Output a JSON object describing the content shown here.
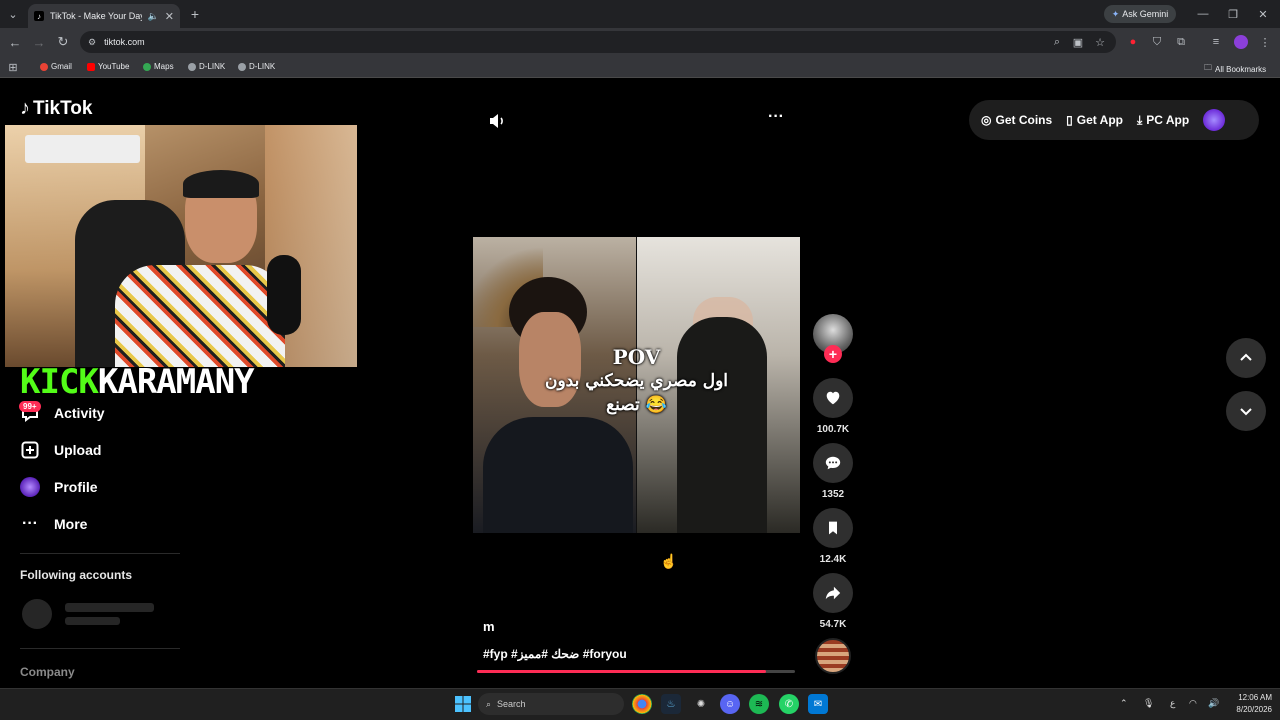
{
  "browser": {
    "tab_title": "TikTok - Make Your Day",
    "url": "tiktok.com",
    "ask_gemini": "Ask Gemini",
    "bookmarks": [
      "Gmail",
      "YouTube",
      "Maps",
      "D-LINK",
      "D-LINK"
    ],
    "all_bookmarks": "All Bookmarks"
  },
  "sidebar": {
    "logo": "TikTok",
    "streamer_overlay": {
      "part1": "KICK",
      "part2": "KARAMANY"
    },
    "badge": "99+",
    "items": [
      {
        "label": "Activity",
        "icon": "activity-icon"
      },
      {
        "label": "Upload",
        "icon": "upload-icon"
      },
      {
        "label": "Profile",
        "icon": "profile-icon"
      },
      {
        "label": "More",
        "icon": "more-icon"
      }
    ],
    "following_title": "Following accounts",
    "company": "Company"
  },
  "video": {
    "caption_line1": "POV",
    "caption_line2": "اول مصري يضحكني بدون",
    "caption_line3": "تصنع 😂",
    "author": "m",
    "hashtags": "#fyp #ضحك #مميز #foryou",
    "progress": 0.91
  },
  "actions": {
    "likes": "100.7K",
    "comments": "1352",
    "saves": "12.4K",
    "shares": "54.7K"
  },
  "topbar": {
    "get_coins": "Get Coins",
    "get_app": "Get App",
    "pc_app": "PC App"
  },
  "taskbar": {
    "search": "Search",
    "time": "12:06 AM",
    "date": "8/20/2026",
    "lang": "ع"
  },
  "colors": {
    "accent": "#fe2c55",
    "kick_green": "#53fc18"
  }
}
